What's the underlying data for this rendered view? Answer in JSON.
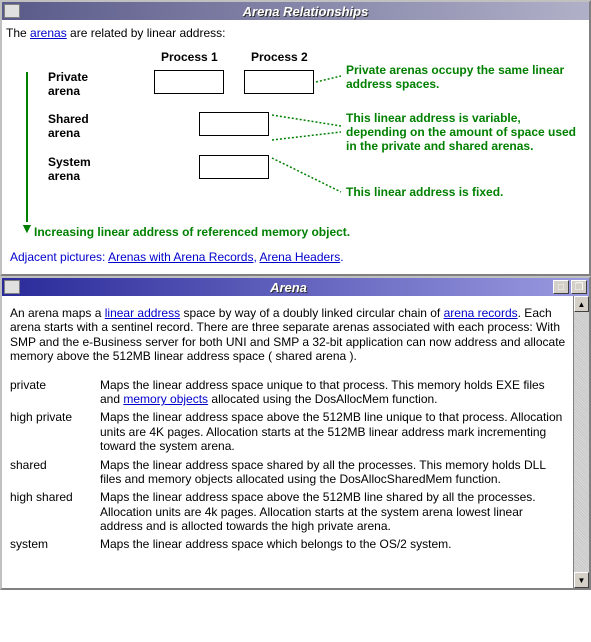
{
  "window1": {
    "title": "Arena Relationships",
    "intro_pre": "The ",
    "intro_link": "arenas",
    "intro_post": " are related by linear address:",
    "col1": "Process 1",
    "col2": "Process 2",
    "row1": "Private arena",
    "row2": "Shared arena",
    "row3": "System arena",
    "ann1": "Private arenas occupy the same linear address spaces.",
    "ann2": "This linear address is variable, depending on the amount of space used in the private and shared arenas.",
    "ann3": "This linear address is fixed.",
    "ann4": "Increasing linear address of referenced memory object.",
    "adj_pre": "Adjacent pictures: ",
    "adj_link1": "Arenas with Arena Records",
    "adj_link2": "Arena Headers",
    "adj_sep": ", ",
    "adj_end": "."
  },
  "window2": {
    "title": "Arena",
    "p_parts": {
      "a": "An arena maps a ",
      "link1": "linear address",
      "b": " space by way of a doubly linked circular chain of ",
      "link2": "arena records",
      "c": ". Each arena starts with a sentinel record. There are three separate arenas associated with each process: With SMP and the e-Business server for both UNI and SMP a 32-bit application can now address and allocate memory above the 512MB linear address space ( shared arena )."
    },
    "defs": [
      {
        "term": "private",
        "pre": "Maps the linear address space unique to that process. This memory holds EXE files and ",
        "link": "memory objects",
        "post": " allocated using the DosAllocMem function."
      },
      {
        "term": "high private",
        "text": "Maps the linear address space above the 512MB line unique to that process. Allocation units are 4K pages. Allocation starts at the 512MB linear address mark incrementing toward the system arena."
      },
      {
        "term": "shared",
        "text": "Maps the linear address space shared by all the processes. This memory holds DLL files and memory objects allocated using the DosAllocSharedMem function."
      },
      {
        "term": "high shared",
        "text": "Maps the linear address space above the 512MB line shared by all the processes.  Allocation units are 4k pages. Allocation starts at the system arena lowest linear address and is allocted towards the high private arena."
      },
      {
        "term": "system",
        "text": "Maps the linear address space which belongs to the OS/2 system."
      }
    ]
  }
}
